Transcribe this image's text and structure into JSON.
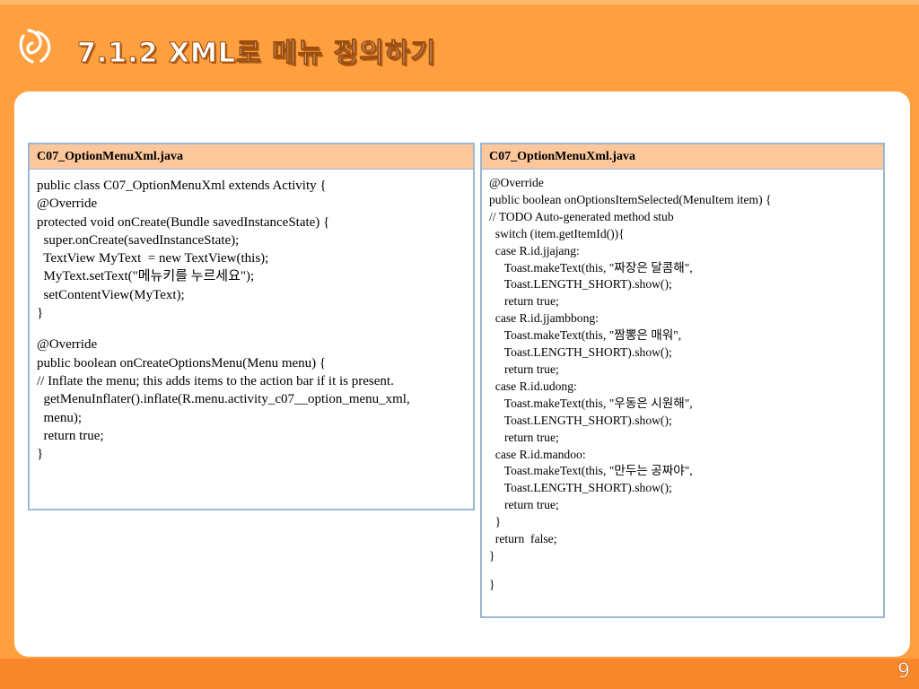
{
  "slide": {
    "title": "7.1.2 XML로 메뉴 정의하기",
    "page_number": "9"
  },
  "colors": {
    "background": "#fea040",
    "header_fill": "#fcc79a",
    "box_border": "#9cb6d4",
    "bottom_band": "#f8862a"
  },
  "logo": {
    "icon": "swirl-logo-icon"
  },
  "left_box": {
    "header": "C07_OptionMenuXml.java",
    "lines": [
      "public class C07_OptionMenuXml extends Activity {",
      "@Override",
      "protected void onCreate(Bundle savedInstanceState) {",
      "  super.onCreate(savedInstanceState);",
      "  TextView MyText  = new TextView(this);",
      "  MyText.setText(\"메뉴키를 누르세요\");",
      "  setContentView(MyText);",
      "}",
      "",
      "@Override",
      "public boolean onCreateOptionsMenu(Menu menu) {",
      "// Inflate the menu; this adds items to the action bar if it is present.",
      "  getMenuInflater().inflate(R.menu.activity_c07__option_menu_xml,",
      "  menu);",
      "  return true;",
      "}"
    ]
  },
  "right_box": {
    "header": "C07_OptionMenuXml.java",
    "lines": [
      "@Override",
      "public boolean onOptionsItemSelected(MenuItem item) {",
      "// TODO Auto-generated method stub",
      "  switch (item.getItemId()){",
      "  case R.id.jjajang:",
      "     Toast.makeText(this, \"짜장은 달콤해\",",
      "     Toast.LENGTH_SHORT).show();",
      "     return true;",
      "  case R.id.jjambbong:",
      "     Toast.makeText(this, \"짬뽕은 매워\",",
      "     Toast.LENGTH_SHORT).show();",
      "     return true;",
      "  case R.id.udong:",
      "     Toast.makeText(this, \"우동은 시원해\",",
      "     Toast.LENGTH_SHORT).show();",
      "     return true;",
      "  case R.id.mandoo:",
      "     Toast.makeText(this, \"만두는 공짜야\",",
      "     Toast.LENGTH_SHORT).show();",
      "     return true;",
      "  }",
      "  return  false;",
      "}",
      "",
      "}"
    ]
  }
}
